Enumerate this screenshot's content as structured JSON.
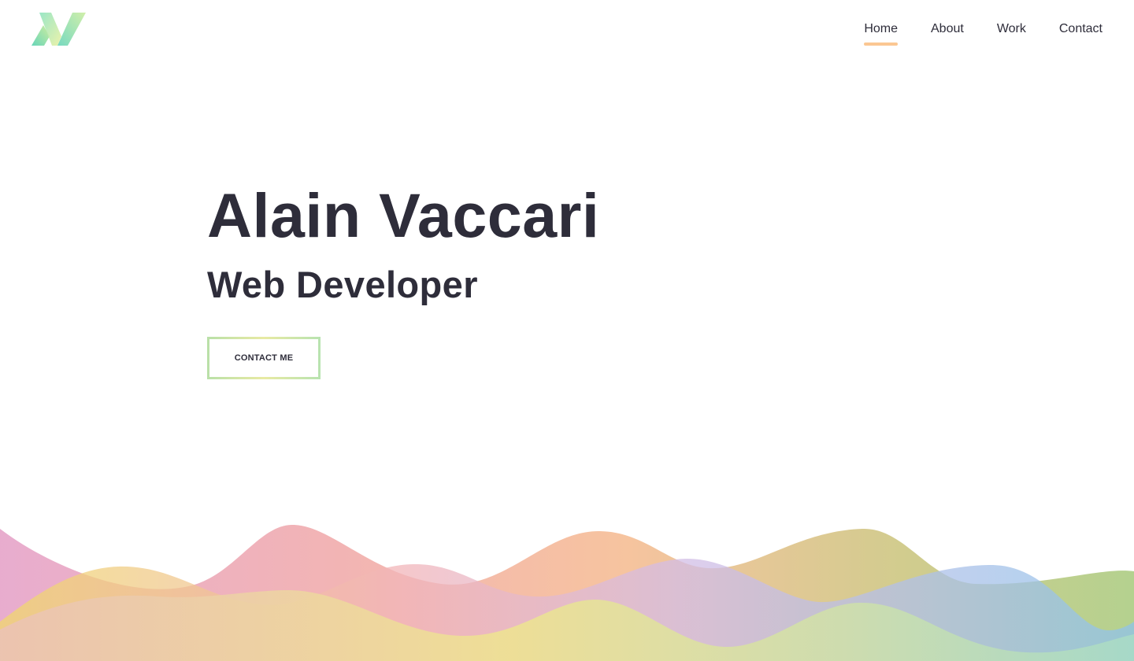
{
  "header": {
    "logo_icon": "av-monogram-logo",
    "nav": [
      {
        "label": "Home",
        "active": true
      },
      {
        "label": "About",
        "active": false
      },
      {
        "label": "Work",
        "active": false
      },
      {
        "label": "Contact",
        "active": false
      }
    ],
    "active_color": "#fbc792"
  },
  "hero": {
    "name": "Alain Vaccari",
    "role": "Web Developer",
    "cta_label": "CONTACT ME"
  },
  "colors": {
    "text": "#2e2d3a",
    "cta_border_start": "#b9e0a8",
    "cta_border_end": "#b8e3b0"
  }
}
